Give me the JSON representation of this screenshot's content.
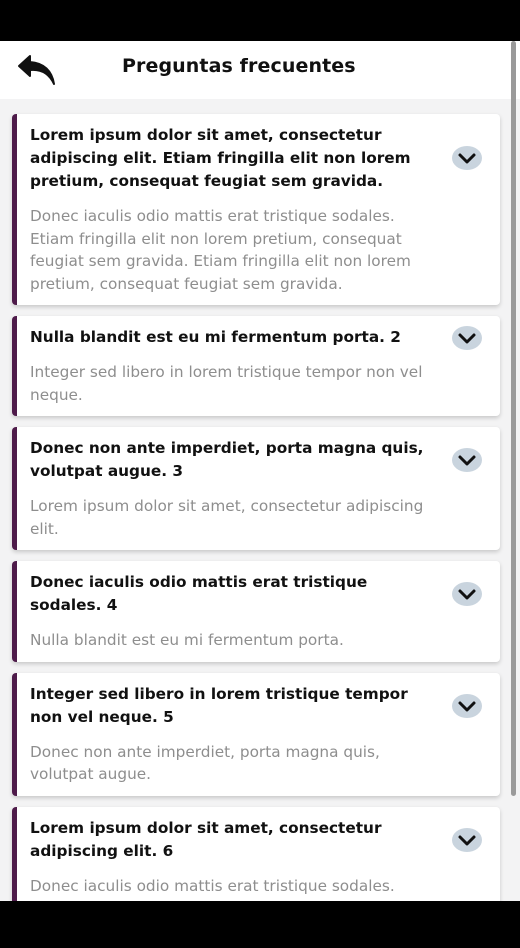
{
  "header": {
    "title": "Preguntas frecuentes"
  },
  "faqs": [
    {
      "question": "Lorem ipsum dolor sit amet, consectetur adipiscing elit. Etiam fringilla elit non lorem pretium, consequat feugiat sem gravida.",
      "answer": "Donec iaculis odio mattis erat tristique sodales. Etiam fringilla elit non lorem pretium, consequat feugiat sem gravida. Etiam fringilla elit non lorem pretium, consequat feugiat sem gravida."
    },
    {
      "question": "Nulla blandit est eu mi fermentum porta. 2",
      "answer": "Integer sed libero in lorem tristique tempor non vel neque."
    },
    {
      "question": "Donec non ante imperdiet, porta magna quis, volutpat augue. 3",
      "answer": "Lorem ipsum dolor sit amet, consectetur adipiscing elit."
    },
    {
      "question": "Donec iaculis odio mattis erat tristique sodales. 4",
      "answer": "Nulla blandit est eu mi fermentum porta."
    },
    {
      "question": "Integer sed libero in lorem tristique tempor non vel neque. 5",
      "answer": "Donec non ante imperdiet, porta magna quis, volutpat augue."
    },
    {
      "question": "Lorem ipsum dolor sit amet, consectetur adipiscing elit. 6",
      "answer": "Donec iaculis odio mattis erat tristique sodales."
    }
  ],
  "icons": {
    "back": "back-arrow-icon",
    "expand": "chevron-down-icon"
  },
  "colors": {
    "accent": "#4e1b4a",
    "chevron_bg": "#c9d4de",
    "answer_text": "#8e8e8e"
  }
}
